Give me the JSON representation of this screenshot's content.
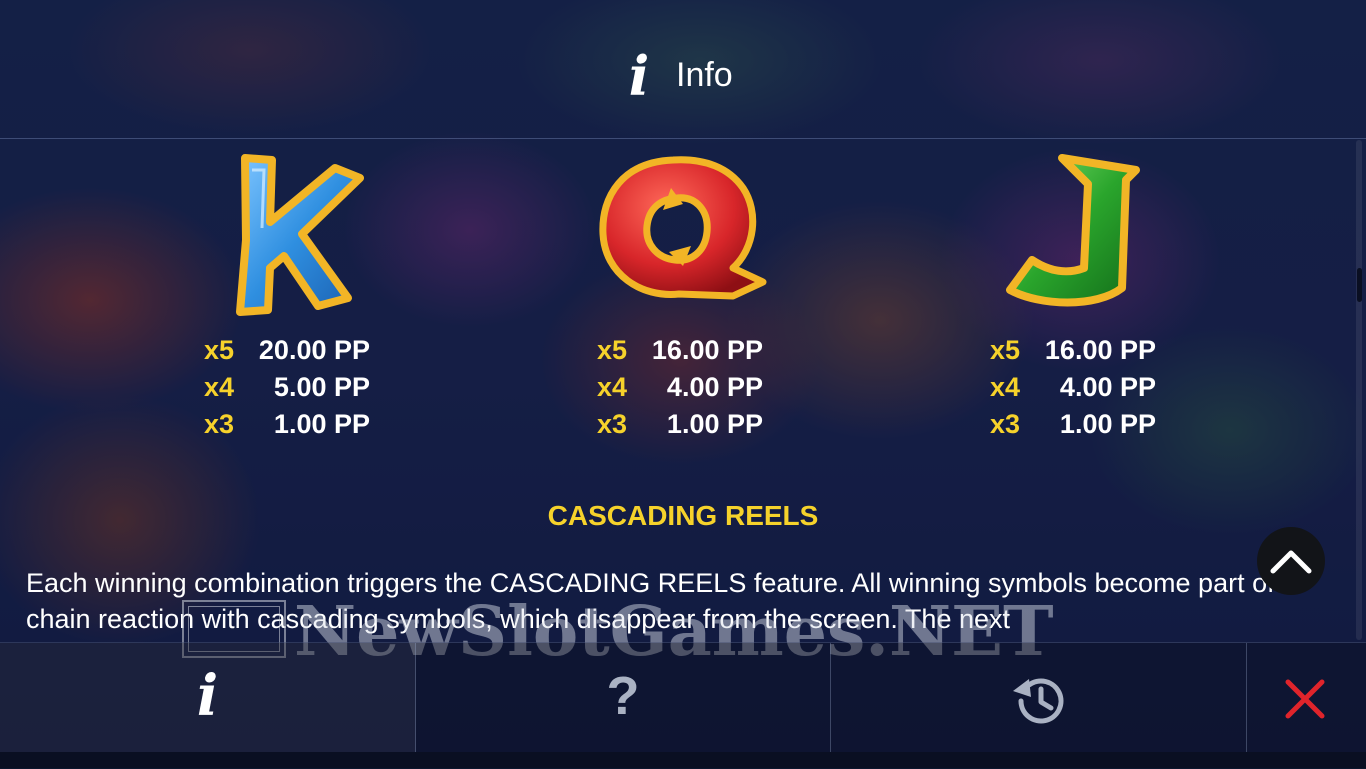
{
  "header": {
    "icon": "info-icon",
    "title": "Info"
  },
  "symbols": [
    {
      "name": "K",
      "icon": "letter-k-symbol",
      "colors": {
        "body": "#2f8fe0",
        "frame": "#f2b526"
      },
      "pays": [
        {
          "mult": "x5",
          "value": "20.00 PP"
        },
        {
          "mult": "x4",
          "value": "5.00 PP"
        },
        {
          "mult": "x3",
          "value": "1.00 PP"
        }
      ]
    },
    {
      "name": "Q",
      "icon": "letter-q-symbol",
      "colors": {
        "body": "#d8262a",
        "frame": "#f2b526"
      },
      "pays": [
        {
          "mult": "x5",
          "value": "16.00 PP"
        },
        {
          "mult": "x4",
          "value": "4.00 PP"
        },
        {
          "mult": "x3",
          "value": "1.00 PP"
        }
      ]
    },
    {
      "name": "J",
      "icon": "letter-j-symbol",
      "colors": {
        "body": "#2aa52c",
        "frame": "#f2b526"
      },
      "pays": [
        {
          "mult": "x5",
          "value": "16.00 PP"
        },
        {
          "mult": "x4",
          "value": "4.00 PP"
        },
        {
          "mult": "x3",
          "value": "1.00 PP"
        }
      ]
    }
  ],
  "feature": {
    "title": "CASCADING REELS",
    "text": "Each winning combination triggers the CASCADING REELS feature. All winning symbols become part of a chain reaction with cascading symbols, which disappear from the screen. The next"
  },
  "watermark": {
    "text": "NewSlotGames.NET",
    "icon": "newslotgames-logo"
  },
  "scroll_up": {
    "icon": "chevron-up-icon"
  },
  "bottom_bar": {
    "tabs": [
      {
        "id": "info",
        "icon": "info-icon",
        "glyph": "i",
        "active": true
      },
      {
        "id": "help",
        "icon": "question-mark-icon",
        "glyph": "?",
        "active": false
      },
      {
        "id": "history",
        "icon": "history-clock-icon",
        "glyph": "",
        "active": false
      },
      {
        "id": "close",
        "icon": "close-icon",
        "glyph": "",
        "active": false
      }
    ]
  },
  "colors": {
    "accent_yellow": "#f6d22b",
    "close_red": "#e0242b",
    "text": "#ffffff"
  }
}
